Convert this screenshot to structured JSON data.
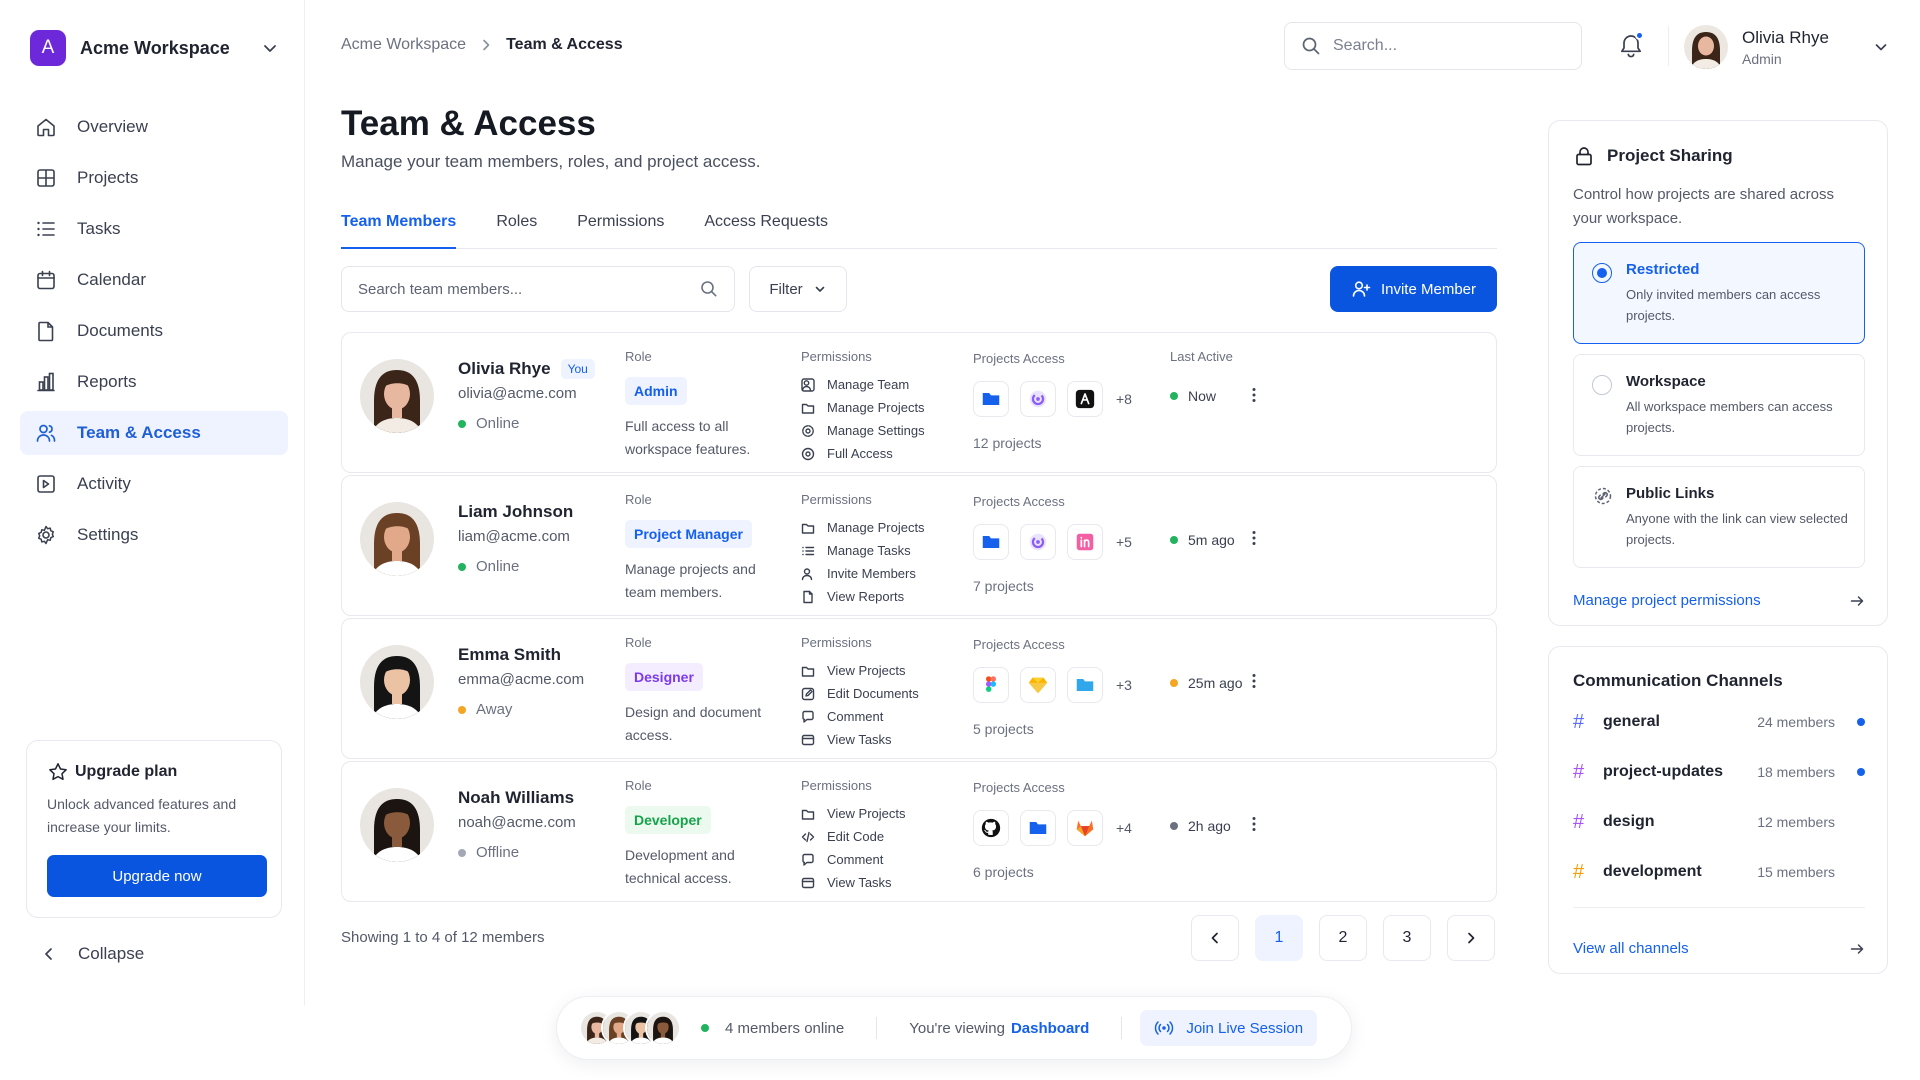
{
  "workspace": {
    "initial": "A",
    "name": "Acme Workspace"
  },
  "nav": {
    "items": [
      {
        "label": "Overview",
        "icon": "home-icon"
      },
      {
        "label": "Projects",
        "icon": "grid-icon"
      },
      {
        "label": "Tasks",
        "icon": "list-icon"
      },
      {
        "label": "Calendar",
        "icon": "calendar-icon"
      },
      {
        "label": "Documents",
        "icon": "document-icon"
      },
      {
        "label": "Reports",
        "icon": "bar-chart-icon"
      },
      {
        "label": "Team & Access",
        "icon": "users-icon",
        "active": true
      },
      {
        "label": "Activity",
        "icon": "activity-icon"
      },
      {
        "label": "Settings",
        "icon": "gear-icon"
      }
    ]
  },
  "upgrade": {
    "title": "Upgrade plan",
    "description": "Unlock advanced features and increase your limits.",
    "button": "Upgrade now"
  },
  "collapse_label": "Collapse",
  "breadcrumb": {
    "parent": "Acme Workspace",
    "current": "Team & Access"
  },
  "search": {
    "placeholder": "Search..."
  },
  "user": {
    "name": "Olivia Rhye",
    "role": "Admin"
  },
  "page": {
    "title": "Team & Access",
    "subtitle": "Manage your team members, roles, and project access."
  },
  "tabs": [
    {
      "label": "Team Members",
      "active": true
    },
    {
      "label": "Roles"
    },
    {
      "label": "Permissions"
    },
    {
      "label": "Access Requests"
    }
  ],
  "toolbar": {
    "search_placeholder": "Search team members...",
    "filter_label": "Filter",
    "invite_label": "Invite Member"
  },
  "labels": {
    "role": "Role",
    "permissions": "Permissions",
    "projects_access": "Projects Access",
    "last_active": "Last Active"
  },
  "members": [
    {
      "name": "Olivia Rhye",
      "you_badge": "You",
      "email": "olivia@acme.com",
      "status": "Online",
      "status_color": "#22b35e",
      "role": "Admin",
      "role_fg": "#1560ec",
      "role_bg": "#eef3ff",
      "role_desc": "Full access to all workspace features.",
      "permissions": [
        {
          "label": "Manage Team",
          "icon": "team-icon"
        },
        {
          "label": "Manage Projects",
          "icon": "folder-icon"
        },
        {
          "label": "Manage Settings",
          "icon": "gear-icon"
        },
        {
          "label": "Full Access",
          "icon": "shield-icon"
        }
      ],
      "projects": [
        "blue-folder-icon",
        "purple-swirl-icon",
        "dark-a-icon"
      ],
      "more": "+8",
      "project_count": "12 projects",
      "last_active": "Now",
      "last_color": "#22b35e",
      "avatar": {
        "skin": "#e8b7a0",
        "hair": "#3b2418",
        "shirt": "#f2ece4"
      }
    },
    {
      "name": "Liam Johnson",
      "email": "liam@acme.com",
      "status": "Online",
      "status_color": "#22b35e",
      "role": "Project Manager",
      "role_fg": "#1560ec",
      "role_bg": "#eef3ff",
      "role_desc": "Manage projects and team members.",
      "permissions": [
        {
          "label": "Manage Projects",
          "icon": "folder-icon"
        },
        {
          "label": "Manage Tasks",
          "icon": "list-icon"
        },
        {
          "label": "Invite Members",
          "icon": "user-plus-icon"
        },
        {
          "label": "View Reports",
          "icon": "document-icon"
        }
      ],
      "projects": [
        "blue-folder-icon",
        "purple-swirl-icon",
        "pink-in-icon"
      ],
      "more": "+5",
      "project_count": "7 projects",
      "last_active": "5m ago",
      "last_color": "#22b35e",
      "avatar": {
        "skin": "#e1a98a",
        "hair": "#6b4126",
        "shirt": "#ffffff"
      }
    },
    {
      "name": "Emma Smith",
      "email": "emma@acme.com",
      "status": "Away",
      "status_color": "#f5a524",
      "role": "Designer",
      "role_fg": "#7c3aed",
      "role_bg": "#f3edff",
      "role_desc": "Design and document access.",
      "permissions": [
        {
          "label": "View Projects",
          "icon": "folder-icon"
        },
        {
          "label": "Edit Documents",
          "icon": "edit-icon"
        },
        {
          "label": "Comment",
          "icon": "comment-icon"
        },
        {
          "label": "View Tasks",
          "icon": "task-icon"
        }
      ],
      "projects": [
        "figma-icon",
        "sketch-icon",
        "light-blue-folder-icon"
      ],
      "more": "+3",
      "project_count": "5 projects",
      "last_active": "25m ago",
      "last_color": "#f5a524",
      "avatar": {
        "skin": "#ecc2a4",
        "hair": "#141414",
        "shirt": "#ffffff"
      }
    },
    {
      "name": "Noah Williams",
      "email": "noah@acme.com",
      "status": "Offline",
      "status_color": "#a3a8b4",
      "role": "Developer",
      "role_fg": "#16a34a",
      "role_bg": "#ebf9ef",
      "role_desc": "Development and technical access.",
      "permissions": [
        {
          "label": "View Projects",
          "icon": "folder-icon"
        },
        {
          "label": "Edit Code",
          "icon": "code-icon"
        },
        {
          "label": "Comment",
          "icon": "comment-icon"
        },
        {
          "label": "View Tasks",
          "icon": "task-icon"
        }
      ],
      "projects": [
        "github-icon",
        "blue-folder-icon",
        "gitlab-icon"
      ],
      "more": "+4",
      "project_count": "6 projects",
      "last_active": "2h ago",
      "last_color": "#6b7180",
      "avatar": {
        "skin": "#8a5a3c",
        "hair": "#1c1410",
        "shirt": "#ffffff"
      }
    }
  ],
  "pagination": {
    "showing": "Showing 1 to 4 of 12 members",
    "pages": [
      "1",
      "2",
      "3"
    ],
    "current": "1"
  },
  "sharing": {
    "title": "Project Sharing",
    "description": "Control how projects are shared across your workspace.",
    "options": [
      {
        "title": "Restricted",
        "description": "Only invited members can access projects.",
        "selected": true
      },
      {
        "title": "Workspace",
        "description": "All workspace members can access projects."
      },
      {
        "title": "Public Links",
        "description": "Anyone with the link can view selected projects.",
        "icon": "link-icon"
      }
    ],
    "manage_link": "Manage project permissions"
  },
  "channels": {
    "title": "Communication Channels",
    "items": [
      {
        "name": "general",
        "members": "24 members",
        "unread": true,
        "hash_color": "#5b6cff"
      },
      {
        "name": "project-updates",
        "members": "18 members",
        "unread": true,
        "hash_color": "#a855f7"
      },
      {
        "name": "design",
        "members": "12 members",
        "unread": false,
        "hash_color": "#a855f7"
      },
      {
        "name": "development",
        "members": "15 members",
        "unread": false,
        "hash_color": "#f59e0b"
      }
    ],
    "view_all": "View all channels"
  },
  "bottom_bar": {
    "online_text": "4 members online",
    "viewing_prefix": "You're viewing",
    "viewing_page": "Dashboard",
    "join_label": "Join Live Session"
  },
  "colors": {
    "primary": "#0a55e0",
    "accent": "#1560ec",
    "online": "#22b35e",
    "away": "#f5a524",
    "offline": "#a3a8b4"
  }
}
